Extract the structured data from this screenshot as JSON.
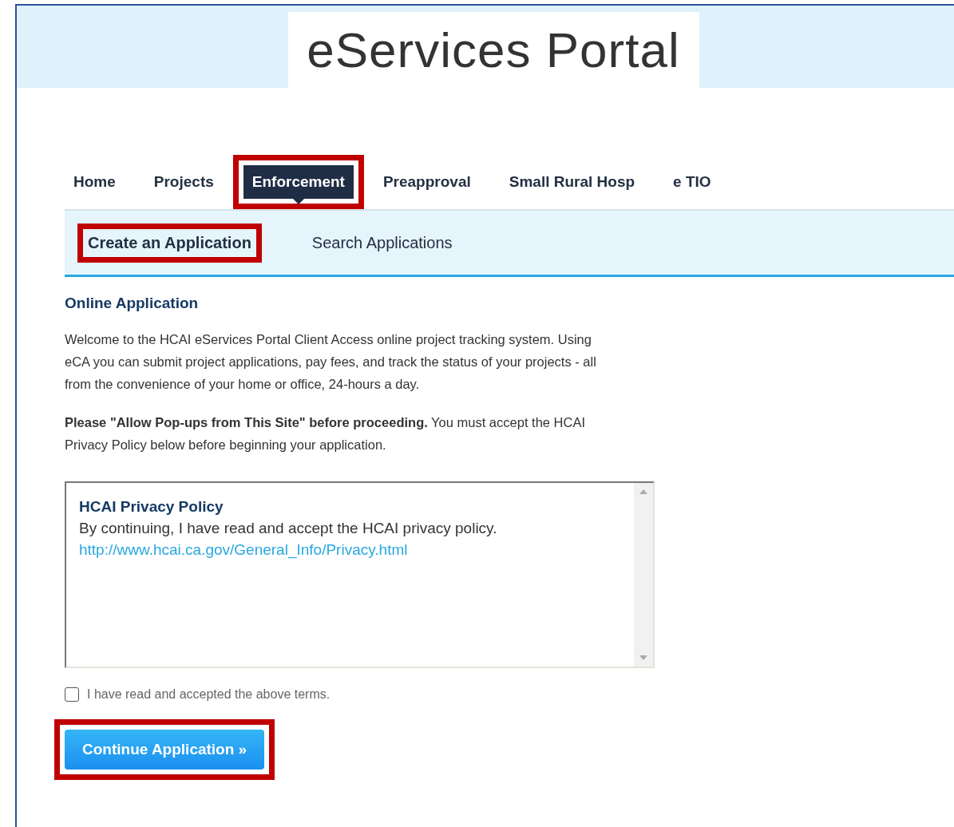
{
  "header": {
    "title": "eServices Portal"
  },
  "nav": [
    {
      "label": "Home",
      "selected": false,
      "highlighted": false
    },
    {
      "label": "Projects",
      "selected": false,
      "highlighted": false
    },
    {
      "label": "Enforcement",
      "selected": true,
      "highlighted": true
    },
    {
      "label": "Preapproval",
      "selected": false,
      "highlighted": false
    },
    {
      "label": "Small Rural Hosp",
      "selected": false,
      "highlighted": false
    },
    {
      "label": "e TIO",
      "selected": false,
      "highlighted": false
    }
  ],
  "subnav": [
    {
      "label": "Create an Application",
      "selected": true,
      "highlighted": true
    },
    {
      "label": "Search Applications",
      "selected": false,
      "highlighted": false
    }
  ],
  "section_title": "Online Application",
  "paragraphs": [
    "Welcome to the HCAI eServices Portal Client Access online project tracking system. Using eCA you can submit project applications, pay fees, and track the status of your projects - all from the convenience of your home or office, 24-hours a day.",
    "**Please \"Allow Pop-ups from This Site\" before proceeding.** You must accept the HCAI Privacy Policy below before beginning your application."
  ],
  "policy_box": {
    "title": "HCAI Privacy Policy",
    "text": "By continuing, I have read and accept the HCAI privacy policy.",
    "link": "http://www.hcai.ca.gov/General_Info/Privacy.html"
  },
  "terms": {
    "label": "I have read and accepted the above terms.",
    "checked": false
  },
  "continue_button": {
    "label": "Continue Application »",
    "highlighted": true
  }
}
